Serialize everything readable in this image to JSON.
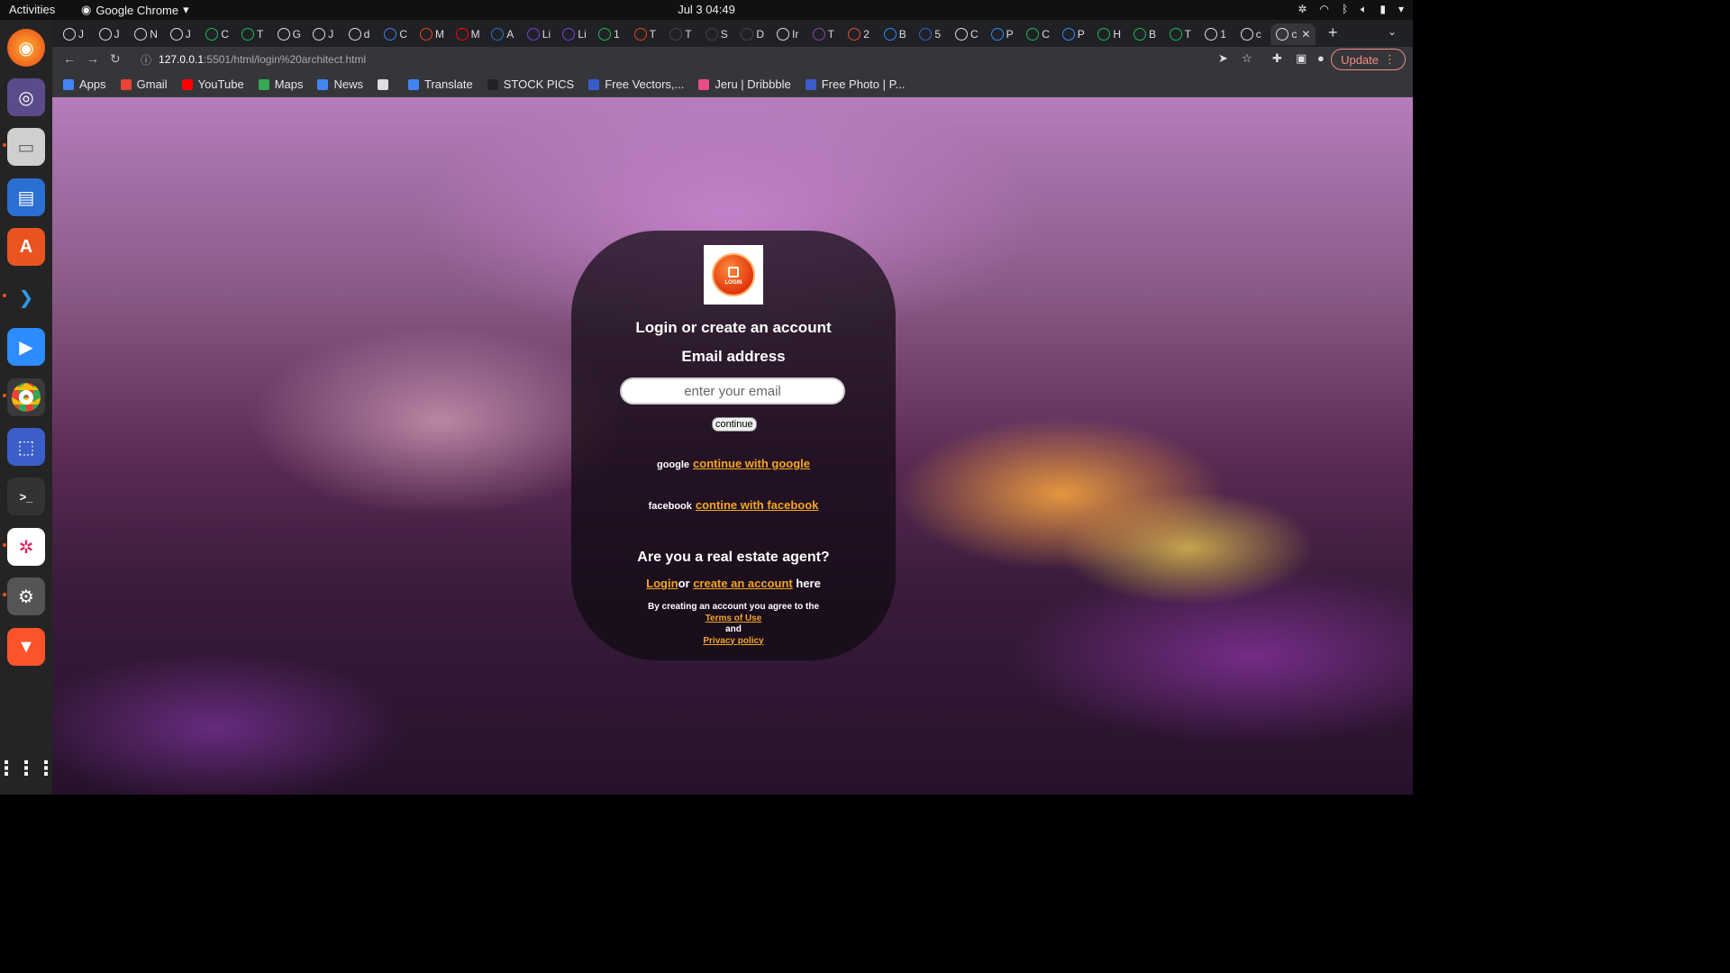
{
  "system": {
    "activities": "Activities",
    "app_name": "Google Chrome",
    "clock": "Jul 3  04:49"
  },
  "tabs": [
    {
      "label": "J"
    },
    {
      "label": "J"
    },
    {
      "label": "N"
    },
    {
      "label": "J"
    },
    {
      "label": "C"
    },
    {
      "label": "T"
    },
    {
      "label": "G"
    },
    {
      "label": "J"
    },
    {
      "label": "d"
    },
    {
      "label": "C"
    },
    {
      "label": "M"
    },
    {
      "label": "M"
    },
    {
      "label": "A"
    },
    {
      "label": "Li"
    },
    {
      "label": "Li"
    },
    {
      "label": "1"
    },
    {
      "label": "T"
    },
    {
      "label": "T"
    },
    {
      "label": "S"
    },
    {
      "label": "D"
    },
    {
      "label": "Ir"
    },
    {
      "label": "T"
    },
    {
      "label": "2"
    },
    {
      "label": "B"
    },
    {
      "label": "5"
    },
    {
      "label": "C"
    },
    {
      "label": "P"
    },
    {
      "label": "C"
    },
    {
      "label": "P"
    },
    {
      "label": "H"
    },
    {
      "label": "B"
    },
    {
      "label": "T"
    },
    {
      "label": "1"
    },
    {
      "label": "c"
    },
    {
      "label": "c"
    }
  ],
  "toolbar": {
    "url_host": "127.0.0.1",
    "url_path": ":5501/html/login%20architect.html",
    "update_label": "Update"
  },
  "bookmarks": [
    {
      "label": "Apps",
      "color": "#4285f4"
    },
    {
      "label": "Gmail",
      "color": "#ea4335"
    },
    {
      "label": "YouTube",
      "color": "#ff0000"
    },
    {
      "label": "Maps",
      "color": "#34a853"
    },
    {
      "label": "News",
      "color": "#4285f4"
    },
    {
      "label": "",
      "color": "#dddddd"
    },
    {
      "label": "Translate",
      "color": "#4285f4"
    },
    {
      "label": "STOCK PICS",
      "color": "#222222"
    },
    {
      "label": "Free Vectors,...",
      "color": "#3b5ccc"
    },
    {
      "label": "Jeru | Dribbble",
      "color": "#ea4c89"
    },
    {
      "label": "Free Photo | P...",
      "color": "#3b5ccc"
    }
  ],
  "card": {
    "logo_text": "LOGIN",
    "title": "Login or create an account",
    "email_label": "Email address",
    "email_placeholder": "enter your email",
    "continue_label": "continue",
    "google_alt": "google",
    "google_link": "continue with google",
    "facebook_alt": "facebook",
    "facebook_link": "contine with facebook",
    "agent_question": "Are you a real estate agent?",
    "agent_login": "Login",
    "agent_or": "or",
    "agent_create": "create an account",
    "agent_here": " here",
    "terms_prefix": "By creating an account you agree to the",
    "terms_link": "Terms of Use",
    "terms_and": "and",
    "privacy_link": "Privacy policy"
  },
  "colors": {
    "link": "#f5a623",
    "card_bg": "rgba(15,10,18,0.72)",
    "update_accent": "#f28b82"
  }
}
